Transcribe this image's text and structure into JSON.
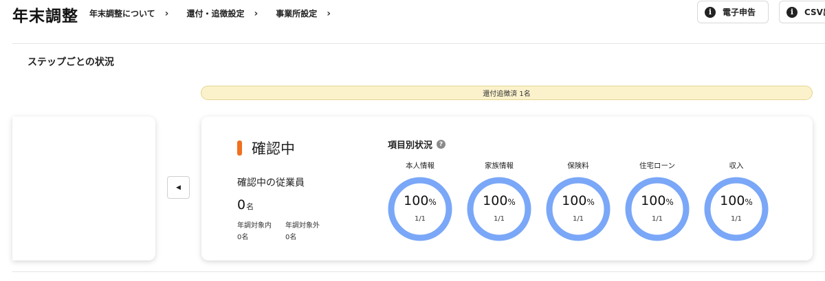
{
  "header": {
    "title": "年末調整",
    "nav": [
      {
        "label": "年末調整について"
      },
      {
        "label": "還付・追徴設定"
      },
      {
        "label": "事業所設定"
      }
    ],
    "buttons": {
      "efile": "電子申告",
      "csv": "CSV出"
    }
  },
  "section": {
    "title": "ステップごとの状況"
  },
  "banner": {
    "text": "還付追徴済 1名"
  },
  "card": {
    "step_title": "確認中",
    "employees_label": "確認中の従業員",
    "count": "0",
    "count_unit": "名",
    "in_scope_label": "年調対象内",
    "in_scope_value": "0名",
    "out_scope_label": "年調対象外",
    "out_scope_value": "0名",
    "items_title": "項目別状況",
    "items": [
      {
        "label": "本人情報",
        "percent": "100",
        "unit": "%",
        "fraction": "1/1",
        "progress": 1.0
      },
      {
        "label": "家族情報",
        "percent": "100",
        "unit": "%",
        "fraction": "1/1",
        "progress": 1.0
      },
      {
        "label": "保険料",
        "percent": "100",
        "unit": "%",
        "fraction": "1/1",
        "progress": 1.0
      },
      {
        "label": "住宅ローン",
        "percent": "100",
        "unit": "%",
        "fraction": "1/1",
        "progress": 1.0
      },
      {
        "label": "収入",
        "percent": "100",
        "unit": "%",
        "fraction": "1/1",
        "progress": 1.0
      }
    ]
  },
  "colors": {
    "ring": "#7aa7f7",
    "ring_track": "#e6ecf8",
    "status_marker": "#f07020",
    "banner_bg": "#fbf2cc"
  },
  "icons": {
    "info": "info-icon",
    "help": "help-icon",
    "chevron": "chevron-right-icon",
    "prev": "caret-left-icon"
  }
}
